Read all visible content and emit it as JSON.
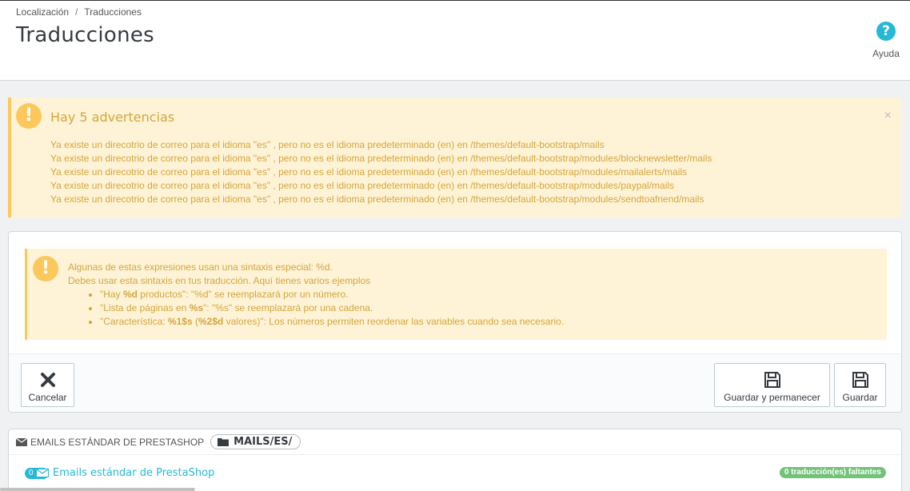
{
  "breadcrumb": {
    "items": [
      "Localización",
      "Traducciones"
    ],
    "separator": "/"
  },
  "page_title": "Traducciones",
  "help": {
    "label": "Ayuda",
    "icon": "question-circle-icon"
  },
  "warnings": {
    "title": "Hay 5 advertencias",
    "close": "×",
    "items": [
      "Ya existe un direcotrio de correo para el idioma \"es\" , pero no es el idioma predeterminado (en) en /themes/default-bootstrap/mails",
      "Ya existe un direcotrio de correo para el idioma \"es\" , pero no es el idioma predeterminado (en) en /themes/default-bootstrap/modules/blocknewsletter/mails",
      "Ya existe un direcotrio de correo para el idioma \"es\" , pero no es el idioma predeterminado (en) en /themes/default-bootstrap/modules/mailalerts/mails",
      "Ya existe un direcotrio de correo para el idioma \"es\" , pero no es el idioma predeterminado (en) en /themes/default-bootstrap/modules/paypal/mails",
      "Ya existe un direcotrio de correo para el idioma \"es\" , pero no es el idioma predeterminado (en) en /themes/default-bootstrap/modules/sendtoafriend/mails"
    ]
  },
  "syntax_info": {
    "line1": "Algunas de estas expresiones usan una sintaxis especial: %d.",
    "line2": "Debes usar esta sintaxis en tus traducción. Aquí tienes varios ejemplos",
    "ex1": {
      "a": "\"Hay ",
      "b": "%d",
      "c": " productos\": \"%d\" se reemplazará por un número."
    },
    "ex2": {
      "a": "\"Lista de páginas en ",
      "b": "%s",
      "c": "\": \"%s\" se reemplazará por una cadena."
    },
    "ex3": {
      "a": "\"Característica: ",
      "b": "%1$s",
      "c": " (",
      "d": "%2$d",
      "e": " valores)\": Los números permiten reordenar las variables cuando sea necesario."
    }
  },
  "toolbar": {
    "cancel_label": "Cancelar",
    "save_stay_label": "Guardar y permanecer",
    "save_label": "Guardar"
  },
  "emails_panel": {
    "heading": "EMAILS ESTÁNDAR DE PRESTASHOP",
    "path": "MAILS/ES/",
    "count": "0",
    "link": "Emails estándar de PrestaShop",
    "missing": "0 traducción(es) faltantes"
  },
  "colors": {
    "warning_bg": "#fff3d7",
    "warning_accent": "#fcc85c",
    "warning_text": "#d2a63c",
    "primary": "#25b9d7",
    "success": "#72c279"
  }
}
